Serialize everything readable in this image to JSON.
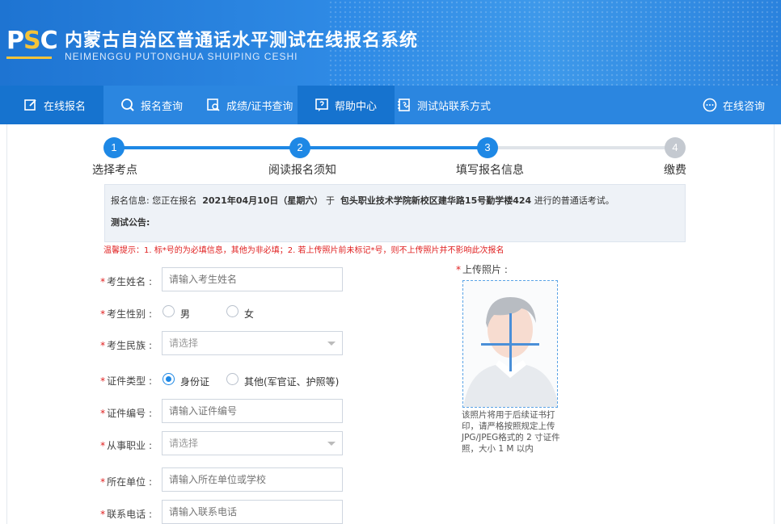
{
  "header": {
    "logo_text_p": "P",
    "logo_text_s": "S",
    "logo_text_c": "C",
    "title": "内蒙古自治区普通话水平测试在线报名系统",
    "subtitle": "NEIMENGGU PUTONGHUA SHUIPING CESHI"
  },
  "nav": {
    "items": [
      {
        "label": "在线报名",
        "icon": "edit-icon",
        "active": true
      },
      {
        "label": "报名查询",
        "icon": "search-icon",
        "active": false
      },
      {
        "label": "成绩/证书查询",
        "icon": "certificate-search-icon",
        "active": false
      },
      {
        "label": "帮助中心",
        "icon": "help-icon",
        "active": true
      },
      {
        "label": "测试站联系方式",
        "icon": "contact-book-icon",
        "active": false
      }
    ],
    "consult": {
      "label": "在线咨询",
      "icon": "chat-icon"
    }
  },
  "steps": [
    {
      "num": "1",
      "label": "选择考点",
      "done": true
    },
    {
      "num": "2",
      "label": "阅读报名须知",
      "done": true
    },
    {
      "num": "3",
      "label": "填写报名信息",
      "done": true
    },
    {
      "num": "4",
      "label": "缴费",
      "done": false
    }
  ],
  "colors": {
    "accent": "#1e88e5",
    "inactive": "#c4c9d0",
    "required": "#e02020"
  },
  "info": {
    "prefix": "报名信息: 您正在报名",
    "date": "2021年04月10日（星期六）",
    "mid": "于",
    "location": "包头职业技术学院新校区建华路15号勤学楼424",
    "suffix": "进行的普通话考试。",
    "notice_label": "测试公告:"
  },
  "warning": "温馨提示：1. 标*号的为必填信息，其他为非必填；2. 若上传照片前未标记*号，则不上传照片并不影响此次报名",
  "form": {
    "name": {
      "label": "考生姓名 :",
      "placeholder": "请输入考生姓名"
    },
    "gender": {
      "label": "考生性别 :",
      "options": [
        "男",
        "女"
      ],
      "selected": null
    },
    "ethnicity": {
      "label": "考生民族 :",
      "value": "请选择"
    },
    "id_type": {
      "label": "证件类型 :",
      "options": [
        "身份证",
        "其他(军官证、护照等)"
      ],
      "selected": "身份证"
    },
    "id_number": {
      "label": "证件编号 :",
      "placeholder": "请输入证件编号"
    },
    "occupation": {
      "label": "从事职业 :",
      "value": "请选择"
    },
    "employer": {
      "label": "所在单位 :",
      "placeholder": "请输入所在单位或学校"
    },
    "phone": {
      "label": "联系电话 :",
      "placeholder": "请输入联系电话"
    }
  },
  "photo": {
    "label": "上传照片 :",
    "note": "该照片将用于后续证书打印，请严格按照规定上传JPG/JPEG格式的 2 寸证件照，大小 1 M 以内"
  }
}
